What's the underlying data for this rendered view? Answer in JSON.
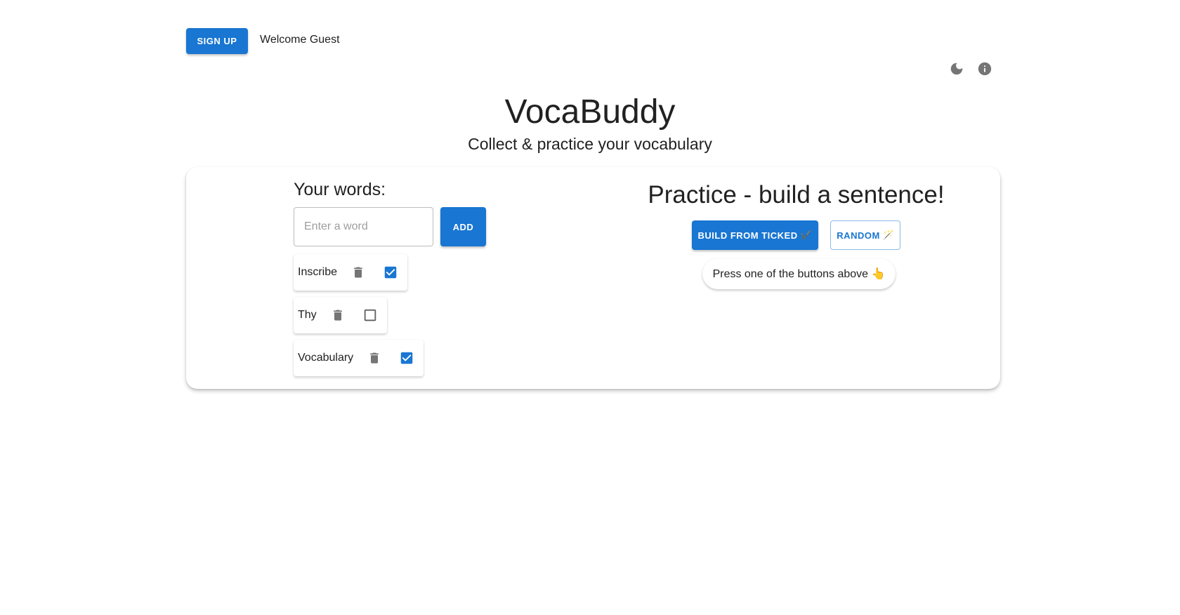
{
  "header": {
    "signup_label": "SIGN UP",
    "welcome_text": "Welcome Guest",
    "title": "VocaBuddy",
    "subtitle": "Collect & practice your vocabulary"
  },
  "icons": {
    "dark_mode": "moon-icon",
    "info": "info-icon",
    "delete": "trash-icon"
  },
  "words_panel": {
    "heading": "Your words:",
    "input_value": "",
    "input_placeholder": "Enter a word",
    "add_label": "ADD",
    "items": [
      {
        "label": "Inscribe",
        "checked": true
      },
      {
        "label": "Thy",
        "checked": false
      },
      {
        "label": "Vocabulary",
        "checked": true
      }
    ]
  },
  "practice_panel": {
    "heading": "Practice - build a sentence!",
    "build_label": "BUILD FROM TICKED",
    "build_emoji": "✔️",
    "random_label": "RANDOM",
    "random_emoji": "🪄",
    "hint": "Press one of the buttons above 👆"
  },
  "colors": {
    "primary": "#1976d2",
    "icon_gray": "#757575",
    "text": "#212121"
  }
}
